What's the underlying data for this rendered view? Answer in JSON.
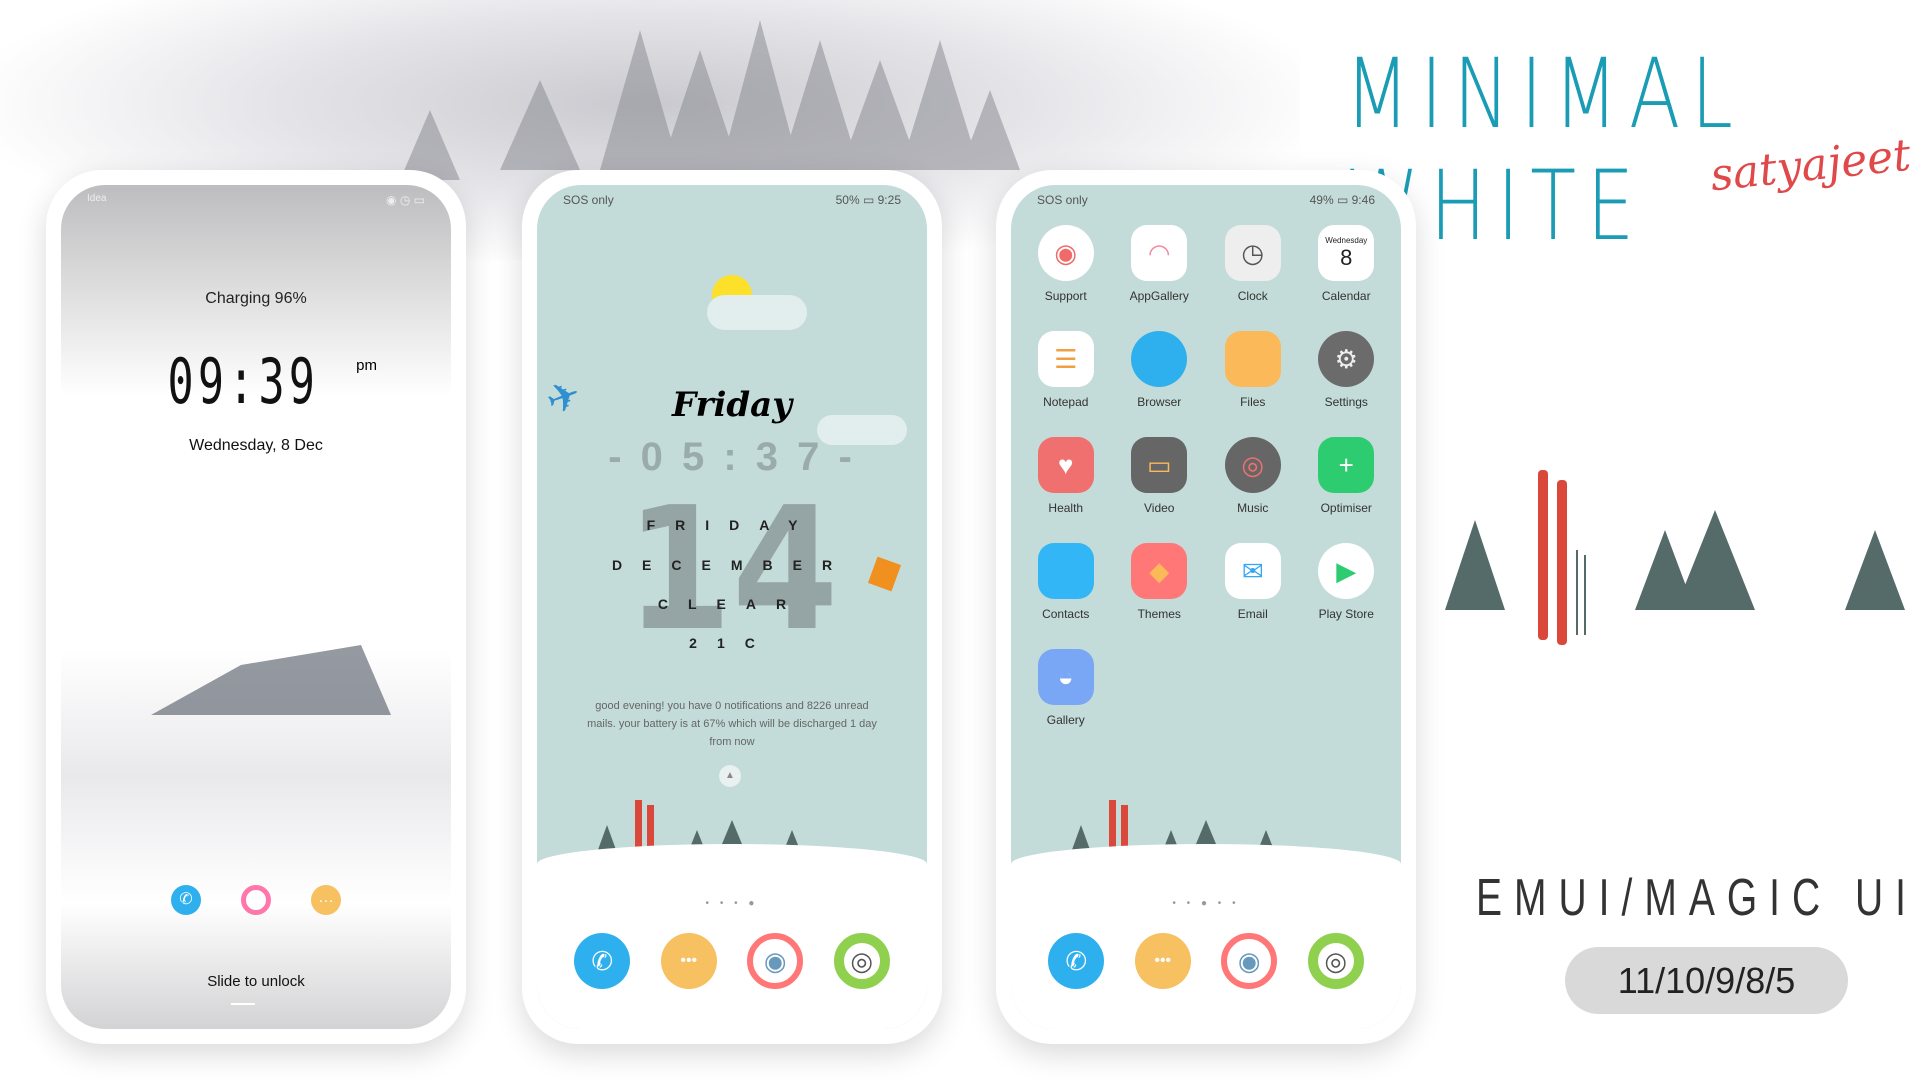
{
  "title": "MINIMAL WHITE",
  "author": "satyajeet",
  "subtitle": "EMUI/MAGIC UI",
  "versions": "11/10/9/8/5",
  "colors": {
    "title": "#1a9cb5",
    "author": "#e0494a",
    "screen_bg": "#c3dcd9",
    "tree": "#546b69",
    "ski": "#d9483b"
  },
  "lock": {
    "status_carrier": "Idea",
    "charging": "Charging 96%",
    "time": "09:39",
    "ampm": "pm",
    "date": "Wednesday, 8 Dec",
    "slide": "Slide to unlock",
    "icons": [
      "phone-icon",
      "camera-icon",
      "messages-icon"
    ]
  },
  "home1": {
    "status_left": "SOS only",
    "status_right": "50% ▭ 9:25",
    "day_script": "Friday",
    "time": "- 0 5 : 3 7 -",
    "big_date": "14",
    "day": "FRIDAY",
    "month": "DECEMBER",
    "weather": "CLEAR",
    "temp": "21C",
    "message": "good evening! you have 0 notifications and 8226 unread mails. your battery is at 67% which will be discharged 1 day from now",
    "page_dots": "• • • ●"
  },
  "home2": {
    "status_left": "SOS only",
    "status_right": "49% ▭ 9:46",
    "page_dots": "• • ● • •",
    "apps": [
      {
        "label": "Support",
        "color": "#ffffff",
        "glyph": "◉",
        "fg": "#f06a6a"
      },
      {
        "label": "AppGallery",
        "color": "#ffffff",
        "glyph": "◠",
        "fg": "#f48a9b"
      },
      {
        "label": "Clock",
        "color": "#eeeeee",
        "glyph": "◷",
        "fg": "#555"
      },
      {
        "label": "Calendar",
        "color": "#ffffff",
        "glyph": "8",
        "fg": "#222",
        "sub": "Wednesday"
      },
      {
        "label": "Notepad",
        "color": "#ffffff",
        "glyph": "☰",
        "fg": "#f0a040"
      },
      {
        "label": "Browser",
        "color": "#2fb0ee",
        "glyph": "",
        "fg": "#fff"
      },
      {
        "label": "Files",
        "color": "#fbb95a",
        "glyph": "",
        "fg": "#fff"
      },
      {
        "label": "Settings",
        "color": "#6b6b6b",
        "glyph": "⚙",
        "fg": "#eee"
      },
      {
        "label": "Health",
        "color": "#f07070",
        "glyph": "♥",
        "fg": "#fff"
      },
      {
        "label": "Video",
        "color": "#666666",
        "glyph": "▭",
        "fg": "#fbb95a"
      },
      {
        "label": "Music",
        "color": "#666666",
        "glyph": "◎",
        "fg": "#f07070"
      },
      {
        "label": "Optimiser",
        "color": "#2ecc71",
        "glyph": "+",
        "fg": "#fff"
      },
      {
        "label": "Contacts",
        "color": "#33b6f5",
        "glyph": "",
        "fg": "#fff"
      },
      {
        "label": "Themes",
        "color": "#f77",
        "glyph": "◆",
        "fg": "#fbb95a"
      },
      {
        "label": "Email",
        "color": "#ffffff",
        "glyph": "✉",
        "fg": "#33a6f5"
      },
      {
        "label": "Play Store",
        "color": "#ffffff",
        "glyph": "▶",
        "fg": "#2ecc71"
      },
      {
        "label": "Gallery",
        "color": "#7aa7f5",
        "glyph": "◒",
        "fg": "#fff"
      }
    ]
  },
  "dock": [
    {
      "icon": "phone-icon",
      "color": "#2fb0ee",
      "glyph": "✆"
    },
    {
      "icon": "messages-icon",
      "color": "#f7c060",
      "glyph": "•••"
    },
    {
      "icon": "camera-icon",
      "color": "#ffffff",
      "glyph": "◉"
    },
    {
      "icon": "browser-icon",
      "color": "#ffffff",
      "glyph": "◎"
    }
  ]
}
